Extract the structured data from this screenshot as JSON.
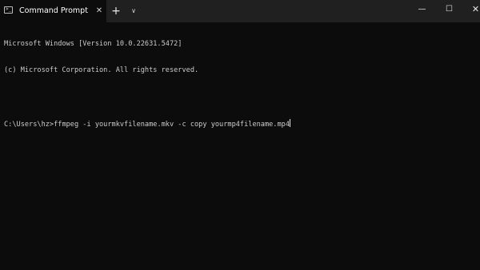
{
  "tab": {
    "icon": "command-prompt-icon",
    "title": "Command Prompt",
    "close_glyph": "✕"
  },
  "tabbar": {
    "new_tab_glyph": "+",
    "dropdown_glyph": "∨"
  },
  "window_controls": {
    "minimize_glyph": "—",
    "maximize_glyph": "☐",
    "close_glyph": "✕"
  },
  "terminal": {
    "lines": [
      "Microsoft Windows [Version 10.0.22631.5472]",
      "(c) Microsoft Corporation. All rights reserved."
    ],
    "prompt": "C:\\Users\\hz>",
    "command": "ffmpeg -i yourmkvfilename.mkv -c copy yourmp4filename.mp4"
  },
  "colors": {
    "background": "#0c0c0c",
    "titlebar": "#202020",
    "text": "#cccccc"
  }
}
